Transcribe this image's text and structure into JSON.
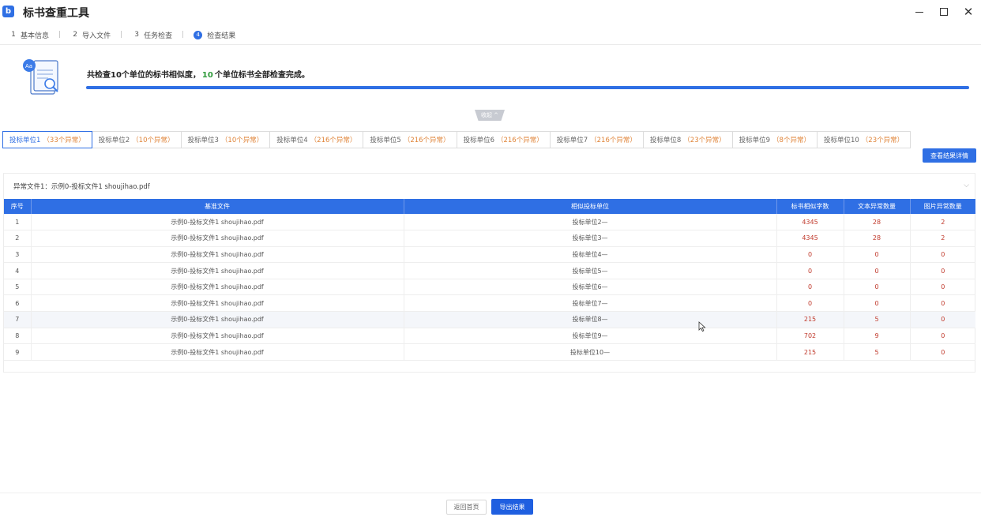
{
  "window": {
    "title": "标书查重工具",
    "logo": "b"
  },
  "steps": [
    {
      "num": "1",
      "label": "基本信息",
      "active": false
    },
    {
      "num": "2",
      "label": "导入文件",
      "active": false
    },
    {
      "num": "3",
      "label": "任务检查",
      "active": false
    },
    {
      "num": "4",
      "label": "检查结果",
      "active": true
    }
  ],
  "banner": {
    "text_pre": "共检查10个单位的标书相似度，",
    "text_highlight": "10",
    "text_post": "个单位标书全部检查完成。",
    "progress": 1.0,
    "collapse_label": "收起 ^"
  },
  "unit_tabs": [
    {
      "label": "投标单位1",
      "count": "（33个异常）",
      "active": true
    },
    {
      "label": "投标单位2",
      "count": "（10个异常）",
      "active": false
    },
    {
      "label": "投标单位3",
      "count": "（10个异常）",
      "active": false
    },
    {
      "label": "投标单位4",
      "count": "（216个异常）",
      "active": false
    },
    {
      "label": "投标单位5",
      "count": "（216个异常）",
      "active": false
    },
    {
      "label": "投标单位6",
      "count": "（216个异常）",
      "active": false
    },
    {
      "label": "投标单位7",
      "count": "（216个异常）",
      "active": false
    },
    {
      "label": "投标单位8",
      "count": "（23个异常）",
      "active": false
    },
    {
      "label": "投标单位9",
      "count": "（8个异常）",
      "active": false
    },
    {
      "label": "投标单位10",
      "count": "（23个异常）",
      "active": false
    }
  ],
  "detail_button": "查看结果详情",
  "panel": {
    "title": "异常文件1：示例0-投标文件1 shoujihao.pdf",
    "columns": [
      "序号",
      "基准文件",
      "相似投标单位",
      "标书相似字数",
      "文本异常数量",
      "图片异常数量"
    ],
    "rows": [
      [
        "1",
        "示例0-投标文件1 shoujihao.pdf",
        "投标单位2—",
        "4345",
        "28",
        "2"
      ],
      [
        "2",
        "示例0-投标文件1 shoujihao.pdf",
        "投标单位3—",
        "4345",
        "28",
        "2"
      ],
      [
        "3",
        "示例0-投标文件1 shoujihao.pdf",
        "投标单位4—",
        "0",
        "0",
        "0"
      ],
      [
        "4",
        "示例0-投标文件1 shoujihao.pdf",
        "投标单位5—",
        "0",
        "0",
        "0"
      ],
      [
        "5",
        "示例0-投标文件1 shoujihao.pdf",
        "投标单位6—",
        "0",
        "0",
        "0"
      ],
      [
        "6",
        "示例0-投标文件1 shoujihao.pdf",
        "投标单位7—",
        "0",
        "0",
        "0"
      ],
      [
        "7",
        "示例0-投标文件1 shoujihao.pdf",
        "投标单位8—",
        "215",
        "5",
        "0"
      ],
      [
        "8",
        "示例0-投标文件1 shoujihao.pdf",
        "投标单位9—",
        "702",
        "9",
        "0"
      ],
      [
        "9",
        "示例0-投标文件1 shoujihao.pdf",
        "投标单位10—",
        "215",
        "5",
        "0"
      ]
    ],
    "hover_row": 6
  },
  "footer": {
    "back_label": "返回首页",
    "export_label": "导出结果"
  },
  "colors": {
    "accent": "#2f6fe4",
    "highlight_green": "#2e9a3a",
    "count_orange": "#e0853a",
    "number_red": "#c0392b"
  }
}
